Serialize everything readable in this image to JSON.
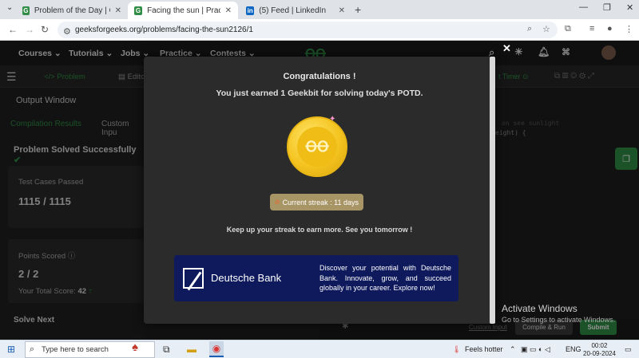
{
  "browser": {
    "tabs": [
      {
        "title": "Problem of the Day | GeeksforG",
        "icon": "G",
        "color": "#2f8d46"
      },
      {
        "title": "Facing the sun | Practice | Geek",
        "icon": "G",
        "color": "#2f8d46"
      },
      {
        "title": "(5) Feed | LinkedIn",
        "icon": "in",
        "color": "#0a66c2"
      }
    ],
    "url": "geeksforgeeks.org/problems/facing-the-sun2126/1"
  },
  "site_nav": [
    "Courses",
    "Tutorials",
    "Jobs",
    "Practice",
    "Contests"
  ],
  "editor_tabs": {
    "problem": "Problem",
    "editorial": "Edito",
    "timer": "t Timer"
  },
  "left_panel": {
    "output_window": "Output Window",
    "tabs": [
      "Compilation Results",
      "Custom Inpu"
    ],
    "solved": "Problem Solved Successfully",
    "tests_label": "Test Cases Passed",
    "tests_value": "1115 / 1115",
    "points_label": "Points Scored",
    "points_value": "2 / 2",
    "total_label": "Your Total Score:",
    "total_value": "42",
    "solve_next": "Solve Next"
  },
  "code_hint": {
    "line1": "on see sunlight",
    "line2": "eight) {"
  },
  "modal": {
    "title": "Congratulations !",
    "subtitle": "You just earned 1 Geekbit for solving today's POTD.",
    "streak": "Current streak : 11 days",
    "keep": "Keep up your streak to earn more. See you tomorrow !",
    "ad_brand": "Deutsche Bank",
    "ad_copy": "Discover your potential with Deutsche Bank. Innovate, grow, and succeed globally in your career. Explore now!"
  },
  "bottom_actions": {
    "custom_input": "Custom Input",
    "compile": "Compile & Run",
    "submit": "Submit"
  },
  "activate": {
    "line1": "Activate Windows",
    "line2": "Go to Settings to activate Windows."
  },
  "taskbar": {
    "search_placeholder": "Type here to search",
    "weather": "Feels hotter",
    "lang": "ENG",
    "time": "00:02",
    "date": "20-09-2024"
  }
}
